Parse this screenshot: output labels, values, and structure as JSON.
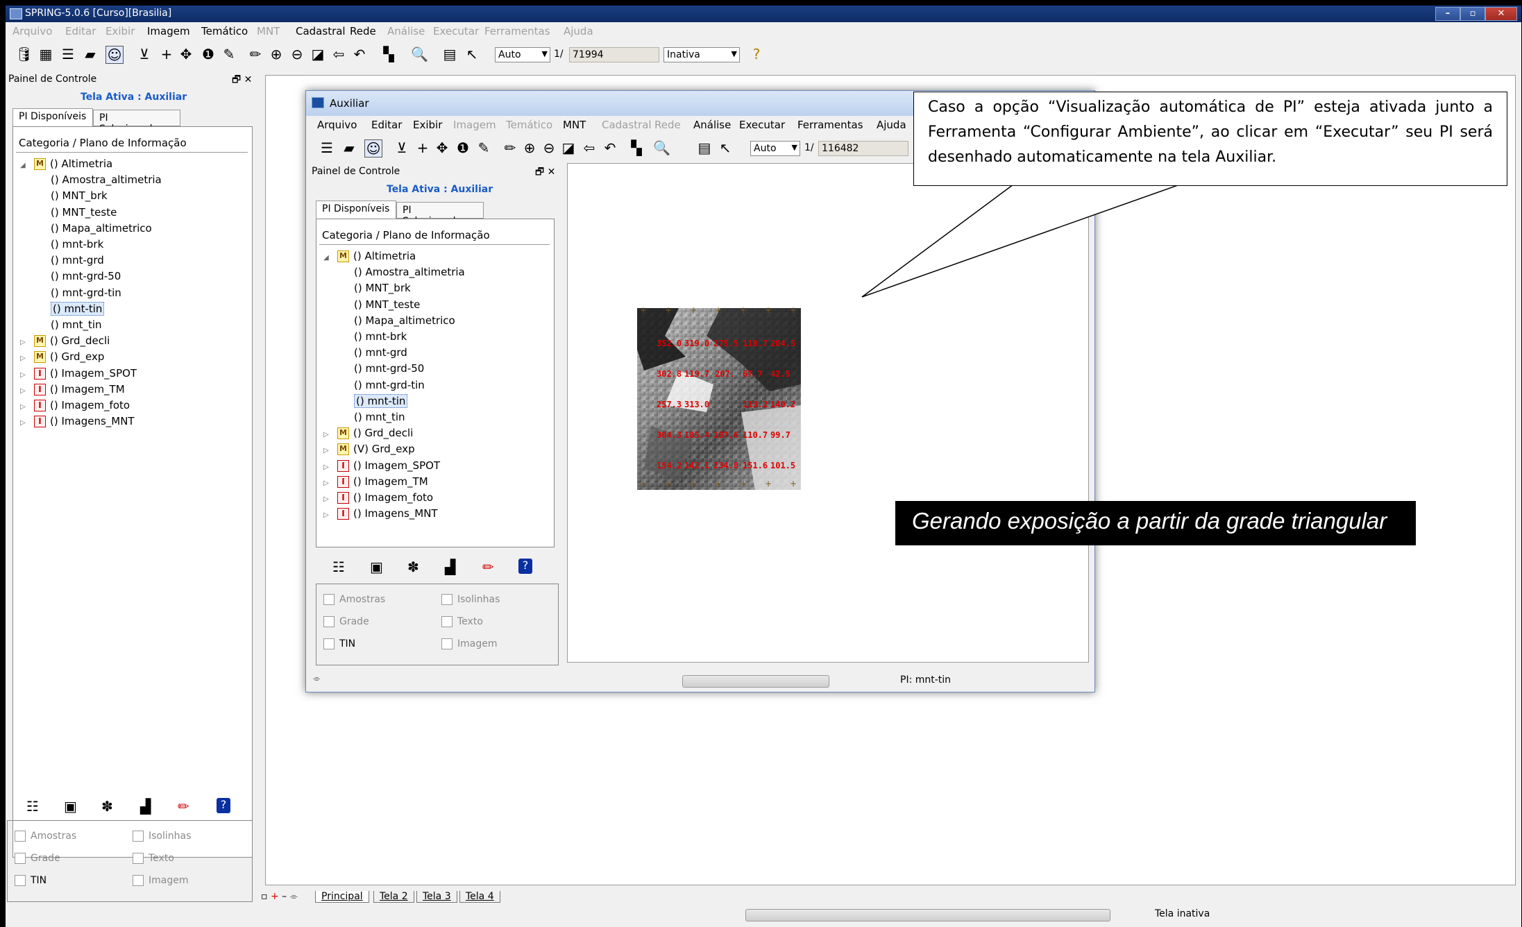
{
  "main_window": {
    "title": "SPRING-5.0.6 [Curso][Brasilia]",
    "menu": [
      {
        "label": "Arquivo",
        "enabled": false
      },
      {
        "label": "Editar",
        "enabled": false
      },
      {
        "label": "Exibir",
        "enabled": false
      },
      {
        "label": "Imagem",
        "enabled": true
      },
      {
        "label": "Temático",
        "enabled": true
      },
      {
        "label": "MNT",
        "enabled": false
      },
      {
        "label": "Cadastral",
        "enabled": true
      },
      {
        "label": "Rede",
        "enabled": true
      },
      {
        "label": "Análise",
        "enabled": false
      },
      {
        "label": "Executar",
        "enabled": false
      },
      {
        "label": "Ferramentas",
        "enabled": false
      },
      {
        "label": "Ajuda",
        "enabled": false
      }
    ],
    "toolbar": {
      "zoom_mode": "Auto",
      "scale_prefix": "1/",
      "scale_value": "71994",
      "status_select": "Inativa"
    },
    "panel": {
      "title": "Painel de Controle",
      "active_screen": "Tela Ativa : Auxiliar",
      "tabs": [
        "PI Disponíveis",
        "PI Selecionados"
      ],
      "header": "Categoria / Plano de Informação",
      "tree": [
        {
          "label": "() Altimetria",
          "type": "M",
          "level": 0,
          "expanded": true
        },
        {
          "label": "() Amostra_altimetria",
          "level": 1
        },
        {
          "label": "() MNT_brk",
          "level": 1
        },
        {
          "label": "() MNT_teste",
          "level": 1
        },
        {
          "label": "() Mapa_altimetrico",
          "level": 1
        },
        {
          "label": "() mnt-brk",
          "level": 1
        },
        {
          "label": "() mnt-grd",
          "level": 1
        },
        {
          "label": "() mnt-grd-50",
          "level": 1
        },
        {
          "label": "() mnt-grd-tin",
          "level": 1
        },
        {
          "label": "() mnt-tin",
          "level": 1,
          "selected": true
        },
        {
          "label": "() mnt_tin",
          "level": 1
        },
        {
          "label": "() Grd_decli",
          "type": "M",
          "level": 0
        },
        {
          "label": "() Grd_exp",
          "type": "M",
          "level": 0
        },
        {
          "label": "() Imagem_SPOT",
          "type": "I",
          "level": 0
        },
        {
          "label": "() Imagem_TM",
          "type": "I",
          "level": 0
        },
        {
          "label": "() Imagem_foto",
          "type": "I",
          "level": 0
        },
        {
          "label": "() Imagens_MNT",
          "type": "I",
          "level": 0
        }
      ],
      "checkboxes": [
        {
          "label": "Amostras",
          "enabled": false
        },
        {
          "label": "Isolinhas",
          "enabled": false
        },
        {
          "label": "Grade",
          "enabled": false
        },
        {
          "label": "Texto",
          "enabled": false
        },
        {
          "label": "TIN",
          "enabled": true
        },
        {
          "label": "Imagem",
          "enabled": false
        }
      ]
    },
    "bottom_tabs": [
      "Principal",
      "Tela 2",
      "Tela 3",
      "Tela 4"
    ],
    "status": "Tela inativa"
  },
  "aux_window": {
    "title": "Auxiliar",
    "menu": [
      {
        "label": "Arquivo",
        "enabled": true
      },
      {
        "label": "Editar",
        "enabled": true
      },
      {
        "label": "Exibir",
        "enabled": true
      },
      {
        "label": "Imagem",
        "enabled": false
      },
      {
        "label": "Temático",
        "enabled": false
      },
      {
        "label": "MNT",
        "enabled": true
      },
      {
        "label": "Cadastral",
        "enabled": false
      },
      {
        "label": "Rede",
        "enabled": false
      },
      {
        "label": "Análise",
        "enabled": true
      },
      {
        "label": "Executar",
        "enabled": true
      },
      {
        "label": "Ferramentas",
        "enabled": true
      },
      {
        "label": "Ajuda",
        "enabled": true
      }
    ],
    "toolbar": {
      "zoom_mode": "Auto",
      "scale_prefix": "1/",
      "scale_value": "116482"
    },
    "panel": {
      "title": "Painel de Controle",
      "active_screen": "Tela Ativa : Auxiliar",
      "tabs": [
        "PI Disponíveis",
        "PI Selecionados"
      ],
      "header": "Categoria / Plano de Informação",
      "tree": [
        {
          "label": "() Altimetria",
          "type": "M",
          "level": 0,
          "expanded": true
        },
        {
          "label": "() Amostra_altimetria",
          "level": 1
        },
        {
          "label": "() MNT_brk",
          "level": 1
        },
        {
          "label": "() MNT_teste",
          "level": 1
        },
        {
          "label": "() Mapa_altimetrico",
          "level": 1
        },
        {
          "label": "() mnt-brk",
          "level": 1
        },
        {
          "label": "() mnt-grd",
          "level": 1
        },
        {
          "label": "() mnt-grd-50",
          "level": 1
        },
        {
          "label": "() mnt-grd-tin",
          "level": 1
        },
        {
          "label": "() mnt-tin",
          "level": 1,
          "selected": true
        },
        {
          "label": "() mnt_tin",
          "level": 1
        },
        {
          "label": "() Grd_decli",
          "type": "M",
          "level": 0
        },
        {
          "label": "(V) Grd_exp",
          "type": "M",
          "level": 0
        },
        {
          "label": "() Imagem_SPOT",
          "type": "I",
          "level": 0
        },
        {
          "label": "() Imagem_TM",
          "type": "I",
          "level": 0
        },
        {
          "label": "() Imagem_foto",
          "type": "I",
          "level": 0
        },
        {
          "label": "() Imagens_MNT",
          "type": "I",
          "level": 0
        }
      ],
      "checkboxes": [
        {
          "label": "Amostras",
          "enabled": false
        },
        {
          "label": "Isolinhas",
          "enabled": false
        },
        {
          "label": "Grade",
          "enabled": false
        },
        {
          "label": "Texto",
          "enabled": false
        },
        {
          "label": "TIN",
          "enabled": true
        },
        {
          "label": "Imagem",
          "enabled": false
        }
      ]
    },
    "status": "PI: mnt-tin",
    "map_labels": [
      "352.0",
      "319.0",
      "275.5",
      "118.7",
      "204.5",
      "302.8",
      "119.7",
      "207.",
      "67.7",
      "42.5",
      "257.3",
      "313.0",
      "113.2",
      "140.2",
      "304.3",
      "185.4",
      "187.6",
      "110.7",
      "99.7",
      "154.2",
      "142.1",
      "234.8",
      "151.6",
      "101.5"
    ]
  },
  "annotation": {
    "text": "Caso a opção “Visualização automática de PI” esteja ativada junto a Ferramenta “Configurar Ambiente”, ao clicar em “Executar” seu PI será desenhado automaticamente na tela Auxiliar."
  },
  "caption": {
    "text": "Gerando exposição a partir da grade triangular"
  }
}
